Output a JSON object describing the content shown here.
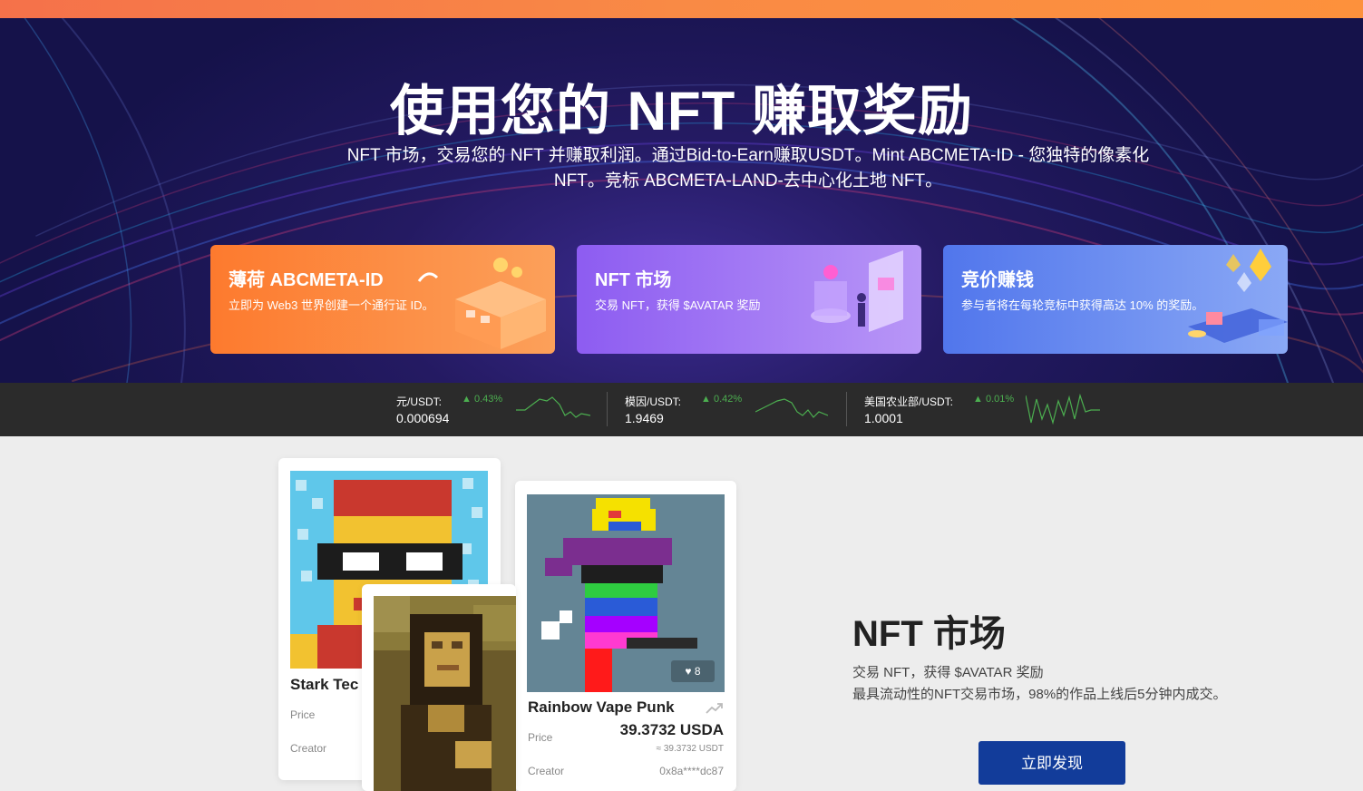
{
  "hero": {
    "title": "使用您的 NFT 赚取奖励",
    "subtitle_line1": "NFT 市场，交易您的 NFT 并赚取利润。通过Bid-to-Earn赚取USDT。Mint ABCMETA-ID - 您独特的像素化",
    "subtitle_line2": "NFT。竞标 ABCMETA-LAND-去中心化土地 NFT。"
  },
  "feature_cards": [
    {
      "title": "薄荷 ABCMETA-ID",
      "desc": "立即为 Web3 世界创建一个通行证 ID。"
    },
    {
      "title": "NFT 市场",
      "desc": "交易 NFT，获得 $AVATAR 奖励"
    },
    {
      "title": "竞价赚钱",
      "desc": "参与者将在每轮竞标中获得高达 10% 的奖励。"
    }
  ],
  "ticker": [
    {
      "pair": "元/USDT:",
      "change": "0.43%",
      "price": "0.000694"
    },
    {
      "pair": "模因/USDT:",
      "change": "0.42%",
      "price": "1.9469"
    },
    {
      "pair": "美国农业部/USDT:",
      "change": "0.01%",
      "price": "1.0001"
    }
  ],
  "nft_cards": {
    "stark": {
      "name": "Stark Tec",
      "price_label": "Price",
      "creator_label": "Creator"
    },
    "punk": {
      "name": "Rainbow Vape Punk",
      "likes": "8",
      "price_label": "Price",
      "price": "39.3732 USDA",
      "price_sub": "≈ 39.3732 USDT",
      "creator_label": "Creator",
      "creator": "0x8a****dc87"
    }
  },
  "market": {
    "title": "NFT 市场",
    "line1": "交易 NFT，获得 $AVATAR 奖励",
    "line2": "最具流动性的NFT交易市场，98%的作品上线后5分钟内成交。",
    "cta": "立即发现"
  },
  "colors": {
    "accent_orange": "#fd7a2e",
    "accent_purple": "#8d5cf1",
    "accent_blue": "#5176ec",
    "cta_blue": "#123c9a",
    "up_green": "#4caf50"
  }
}
